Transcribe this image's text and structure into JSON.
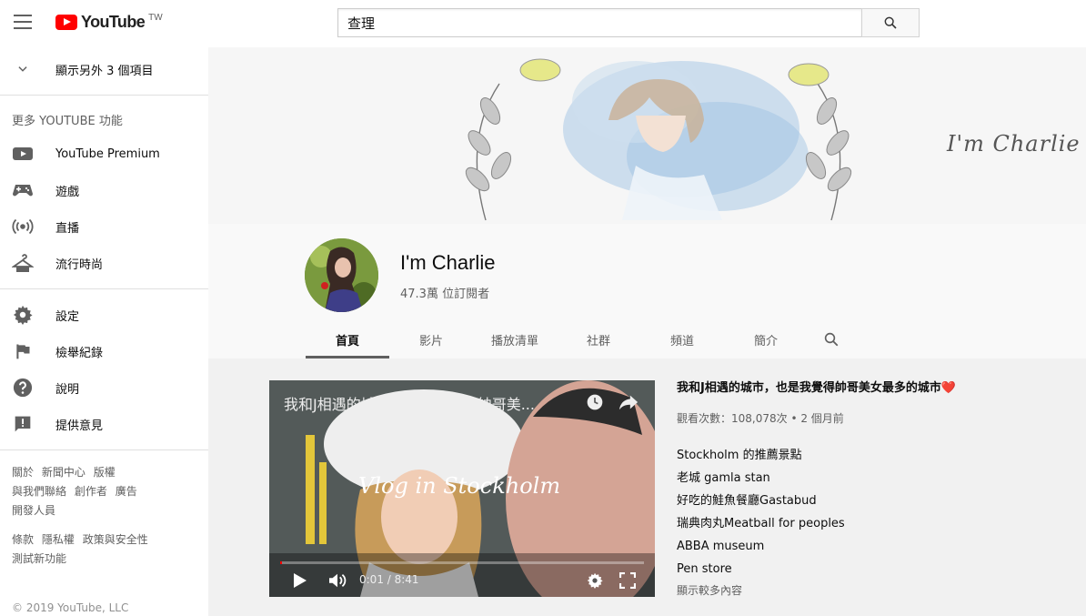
{
  "header": {
    "logo_text": "YouTube",
    "region": "TW",
    "search_value": "查理"
  },
  "sidebar": {
    "show_more": "顯示另外 3 個項目",
    "more_heading": "更多 YOUTUBE 功能",
    "features": [
      {
        "label": "YouTube Premium",
        "icon": "youtube-premium-icon"
      },
      {
        "label": "遊戲",
        "icon": "gaming-icon"
      },
      {
        "label": "直播",
        "icon": "live-icon"
      },
      {
        "label": "流行時尚",
        "icon": "fashion-icon"
      }
    ],
    "settings": [
      {
        "label": "設定",
        "icon": "gear-icon"
      },
      {
        "label": "檢舉紀錄",
        "icon": "flag-icon"
      },
      {
        "label": "說明",
        "icon": "help-icon"
      },
      {
        "label": "提供意見",
        "icon": "feedback-icon"
      }
    ],
    "links_row1": [
      "關於",
      "新聞中心",
      "版權"
    ],
    "links_row2": [
      "與我們聯絡",
      "創作者",
      "廣告"
    ],
    "links_row3": [
      "開發人員"
    ],
    "links_row4": [
      "條款",
      "隱私權",
      "政策與安全性"
    ],
    "links_row5": [
      "測試新功能"
    ],
    "copyright": "© 2019 YouTube, LLC"
  },
  "channel": {
    "banner_text": "I'm  Charlie",
    "name": "I'm Charlie",
    "subscribers": "47.3萬 位訂閱者",
    "tabs": [
      "首頁",
      "影片",
      "播放清單",
      "社群",
      "頻道",
      "簡介"
    ],
    "active_tab": "首頁"
  },
  "featured_video": {
    "overlay_title": "我和J相遇的城市，也是我覺得帥哥美...",
    "overlay_text": "Vlog in Stockholm",
    "current_time": "0:01",
    "duration": "8:41",
    "time_display": "0:01 / 8:41",
    "progress": 0.002,
    "title": "我和J相遇的城市，也是我覺得帥哥美女最多的城市",
    "title_emoji": "❤️",
    "meta": "觀看次數：108,078次 • 2 個月前",
    "description_lines": [
      "Stockholm 的推薦景點",
      "老城 gamla stan",
      "好吃的鮭魚餐廳Gastabud",
      "瑞典肉丸Meatball for peoples",
      "ABBA museum",
      "Pen store"
    ],
    "show_more": "顯示較多內容"
  }
}
